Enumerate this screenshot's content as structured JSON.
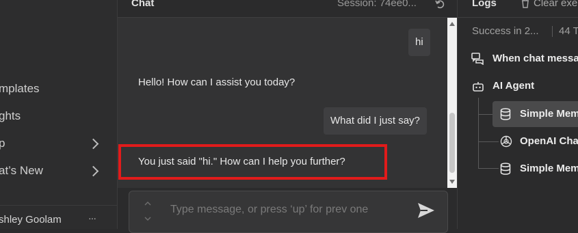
{
  "sidebar": {
    "items": [
      {
        "label": "mplates"
      },
      {
        "label": "ghts"
      },
      {
        "label": "p"
      },
      {
        "label": "at’s New"
      }
    ],
    "user_name": "shley Goolam",
    "more_label": "···"
  },
  "chat": {
    "title": "Chat",
    "session": "Session: 74ee0...",
    "messages": [
      {
        "role": "user",
        "text": "hi"
      },
      {
        "role": "assistant",
        "text": "Hello! How can I assist you today?"
      },
      {
        "role": "user",
        "text": "What did I just say?"
      },
      {
        "role": "assistant",
        "text": "You just said \"hi.\" How can I help you further?"
      }
    ],
    "input_placeholder": "Type message, or press ‘up’ for prev one"
  },
  "logs": {
    "title": "Logs",
    "clear_label": "Clear exe",
    "status_text": "Success in 2...",
    "tokens_text": "44 T",
    "nodes": [
      {
        "label": "When chat messa",
        "icon": "chat-bubbles-icon"
      },
      {
        "label": "AI Agent",
        "icon": "robot-icon"
      },
      {
        "label": "Simple Mem",
        "icon": "database-icon",
        "selected": true
      },
      {
        "label": "OpenAI Cha",
        "icon": "openai-icon"
      },
      {
        "label": "Simple Mem",
        "icon": "database-icon"
      }
    ]
  },
  "colors": {
    "background": "#2b2b2c",
    "highlight": "#e11b1b",
    "selected_row": "#4a4a4b"
  }
}
